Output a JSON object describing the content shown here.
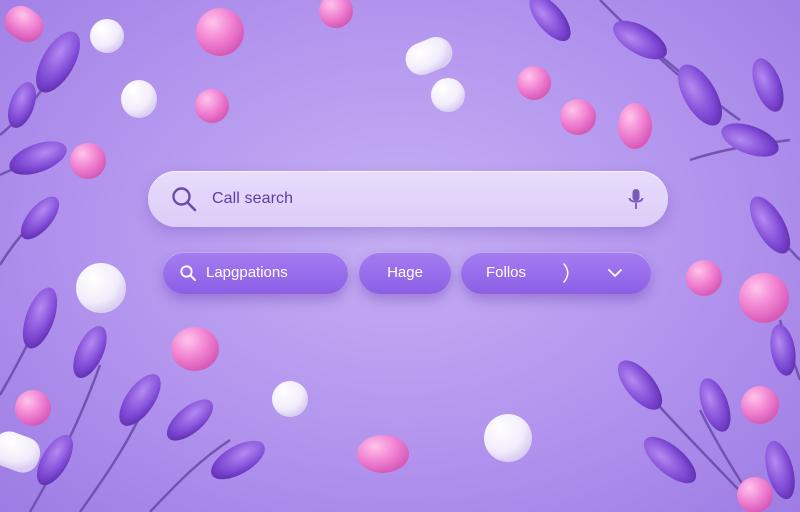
{
  "search": {
    "text": "Call search",
    "icon": "search-icon",
    "mic_icon": "microphone-icon"
  },
  "filters": [
    {
      "label": "Lapgpations",
      "icon": "search-icon"
    },
    {
      "label": "Hage"
    },
    {
      "label": "Follos",
      "icon": "chevron-down-icon"
    }
  ],
  "colors": {
    "background": "#b294ee",
    "search_bar": "#e2d6fa",
    "chip": "#9a6eeb",
    "text_accent": "#5b3fa2",
    "chip_text": "#ffffff"
  }
}
